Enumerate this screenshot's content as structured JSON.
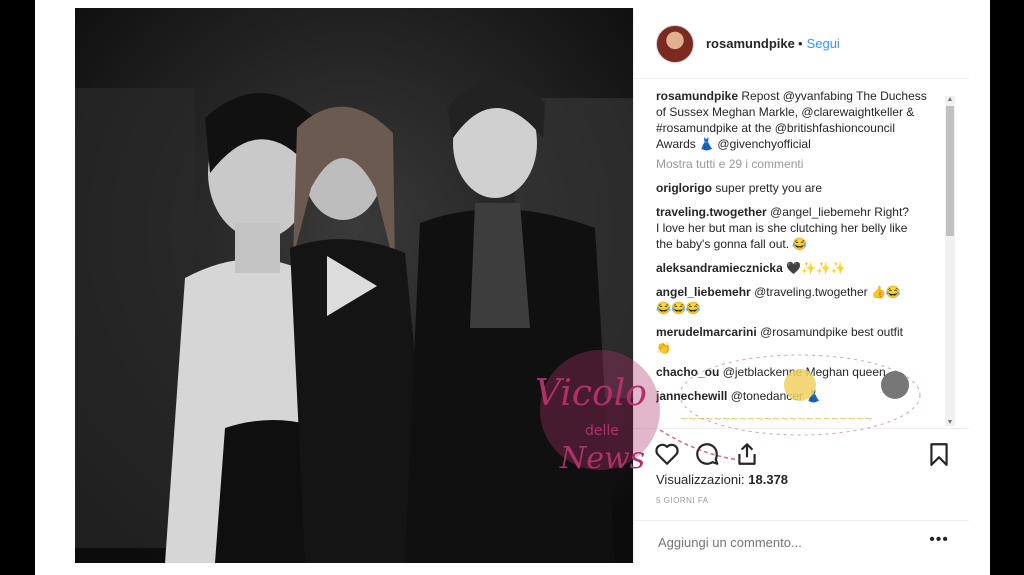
{
  "post": {
    "username": "rosamundpike",
    "follow_label": "Segui",
    "caption_user": "rosamundpike",
    "caption_text": "Repost @yvanfabing The Duchess of Sussex Meghan Markle, @clarewaightkeller & #rosamundpike at the @britishfashioncouncil Awards 👗 @givenchyofficial",
    "show_comments": "Mostra tutti e 29 i commenti"
  },
  "comments": [
    {
      "user": "origlorigo",
      "text": "super pretty you are"
    },
    {
      "user": "traveling.twogether",
      "text": "@angel_liebemehr Right? I love her but man is she clutching her belly like the baby's gonna fall out. 😂"
    },
    {
      "user": "aleksandramiecznicka",
      "text": "🖤✨✨✨"
    },
    {
      "user": "angel_liebemehr",
      "text": "@traveling.twogether 👍😂😂😂😂"
    },
    {
      "user": "merudelmarcarini",
      "text": "@rosamundpike best outfit 👏"
    },
    {
      "user": "chacho_ou",
      "text": "@jetblackenne Meghan queen"
    },
    {
      "user": "jannechewill",
      "text": "@tonedancer 👗"
    }
  ],
  "stats": {
    "views_label": "Visualizzazioni:",
    "views_value": "18.378",
    "date": "5 GIORNI FA"
  },
  "composer": {
    "placeholder": "Aggiungi un commento...",
    "more": "•••"
  },
  "watermark": {
    "line1": "Vicolo",
    "line2": "delle",
    "line3": "News"
  },
  "icons": {
    "like": "heart-icon",
    "comment": "comment-icon",
    "share": "share-icon",
    "save": "bookmark-icon",
    "play": "play-icon"
  },
  "colors": {
    "link": "#3897f0",
    "text": "#262626",
    "muted": "#999999",
    "watermark": "#b0306a"
  }
}
